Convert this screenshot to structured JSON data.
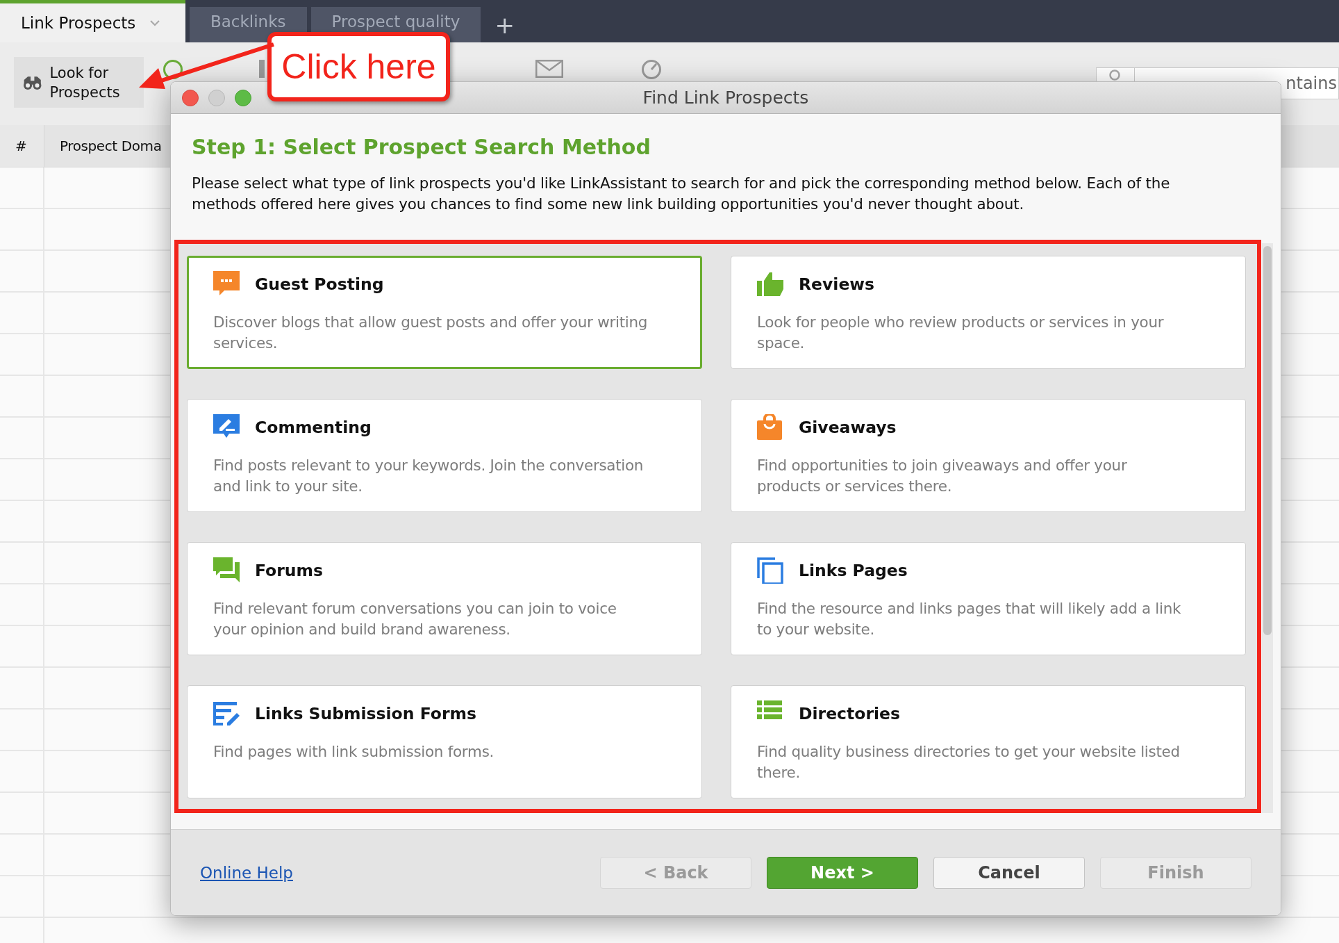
{
  "tabs": [
    {
      "label": "Link Prospects",
      "selected": true,
      "dropdown": true
    },
    {
      "label": "Backlinks",
      "selected": false,
      "dropdown": false
    },
    {
      "label": "Prospect quality",
      "selected": false,
      "dropdown": false
    }
  ],
  "add_tab": "+",
  "toolbar": {
    "items": [
      {
        "kind": "binoculars",
        "label": "Look for Prospects"
      },
      {
        "kind": "add"
      },
      {
        "kind": "update"
      },
      {
        "kind": "email"
      },
      {
        "kind": "verify"
      }
    ],
    "quick_filter": {
      "placeholder": "ntains"
    }
  },
  "table": {
    "columns": [
      "#",
      "Prospect Doma"
    ]
  },
  "dialog": {
    "title": "Find Link Prospects",
    "heading": "Step 1: Select Prospect Search Method",
    "description": "Please select what type of link prospects you'd like LinkAssistant to search for and pick the corresponding method below. Each of the methods offered here gives you chances to find some new link building opportunities you'd never thought about.",
    "methods": [
      {
        "kind": "guest",
        "title": "Guest Posting",
        "description": "Discover blogs that allow guest posts and offer your writing services.",
        "selected": true
      },
      {
        "kind": "reviews",
        "title": "Reviews",
        "description": "Look for people who review products or services in your space.",
        "selected": false
      },
      {
        "kind": "commenting",
        "title": "Commenting",
        "description": "Find posts relevant to your keywords. Join the conversation and link to your site.",
        "selected": false
      },
      {
        "kind": "giveaways",
        "title": "Giveaways",
        "description": "Find opportunities to join giveaways and offer your products or services there.",
        "selected": false
      },
      {
        "kind": "forums",
        "title": "Forums",
        "description": "Find relevant forum conversations you can join to voice your opinion and build brand awareness.",
        "selected": false
      },
      {
        "kind": "links",
        "title": "Links Pages",
        "description": "Find the resource and links pages that will likely add a link to your website.",
        "selected": false
      },
      {
        "kind": "submission",
        "title": "Links Submission Forms",
        "description": "Find pages with link submission forms.",
        "selected": false
      },
      {
        "kind": "directories",
        "title": "Directories",
        "description": "Find quality business directories to get your website listed there.",
        "selected": false
      }
    ],
    "help_link": "Online Help",
    "buttons": [
      {
        "label": "< Back",
        "kind": "normal",
        "disabled": true
      },
      {
        "label": "Next >",
        "kind": "primary",
        "disabled": false
      },
      {
        "label": "Cancel",
        "kind": "normal",
        "disabled": false
      },
      {
        "label": "Finish",
        "kind": "normal",
        "disabled": true
      }
    ]
  },
  "callout": {
    "text": "Click here"
  }
}
